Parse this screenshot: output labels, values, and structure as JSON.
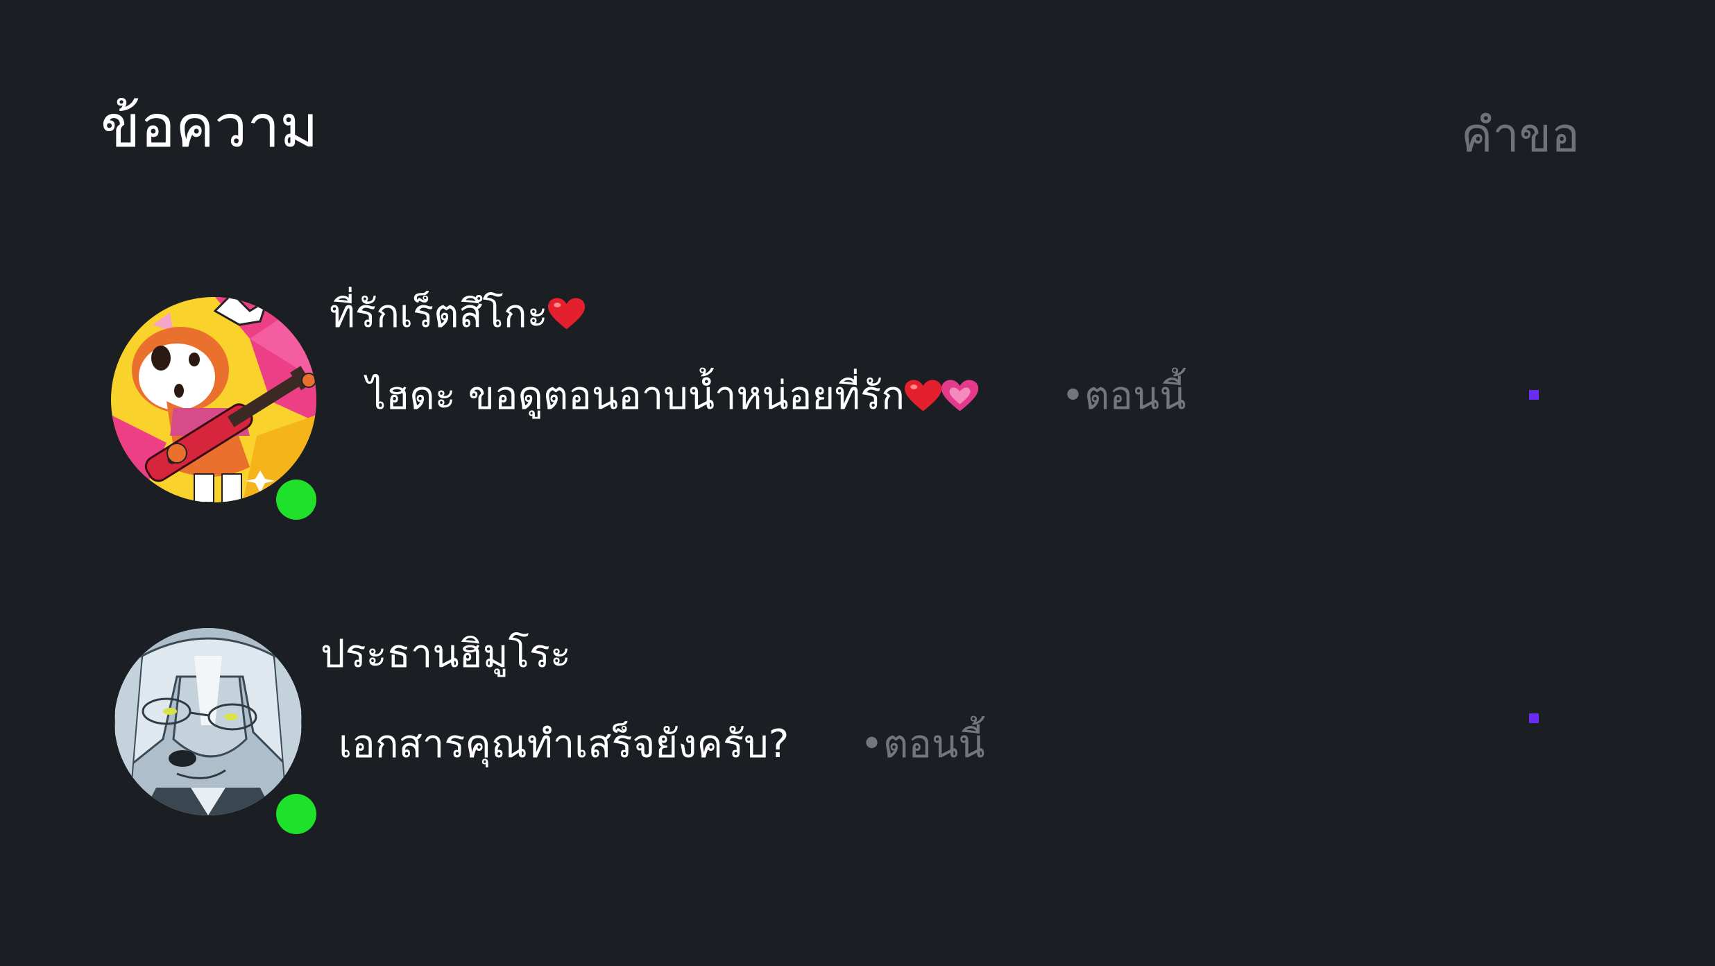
{
  "header": {
    "title": "ข้อความ",
    "requests_label": "คำขอ"
  },
  "conversations": [
    {
      "name": "ที่รักเร็ตสึโกะ",
      "name_emoji": "red-heart-icon",
      "message": "ไฮดะ ขอดูตอนอาบน้ำหน่อยที่รัก",
      "message_emojis": [
        "red-heart-icon",
        "pink-heart-icon"
      ],
      "timestamp": "•ตอนนี้",
      "online": true,
      "unread": true,
      "avatar": "red-panda-guitarist-avatar"
    },
    {
      "name": "ประธานฮิมูโระ",
      "message": "เอกสารคุณทำเสร็จยังครับ?",
      "timestamp": "•ตอนนี้",
      "online": true,
      "unread": true,
      "avatar": "grey-haired-dog-with-glasses-avatar"
    }
  ],
  "colors": {
    "background": "#1b1e22",
    "online": "#1fe02b",
    "unread": "#6a2cf5",
    "muted_text": "#73767b"
  }
}
